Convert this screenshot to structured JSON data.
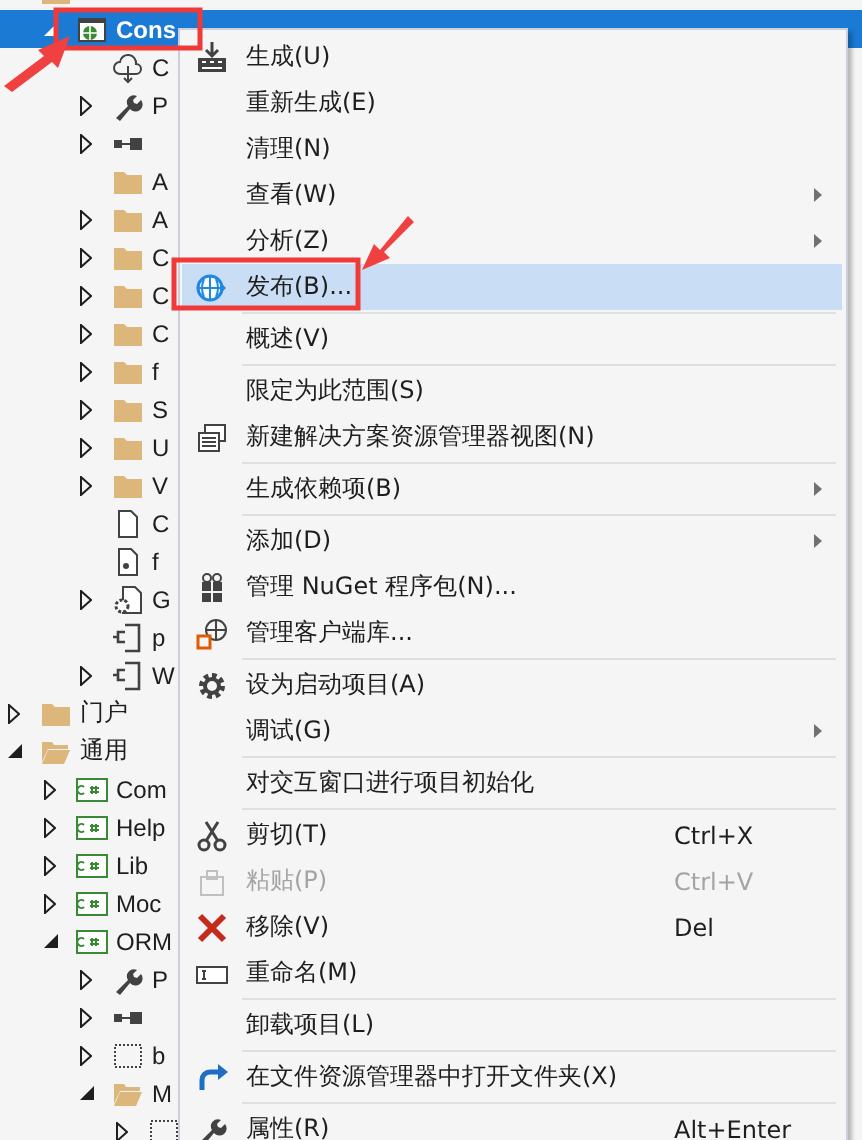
{
  "tree": {
    "items": [
      {
        "kind": "folder",
        "children": [
          {
            "label": "Cons",
            "kind": "web-project",
            "expanded": true,
            "selected": true,
            "children": [
              {
                "label": "C",
                "kind": "connected",
                "selected": false
              },
              {
                "label": "P",
                "kind": "properties",
                "expanded": false,
                "selected": false
              },
              {
                "kind": "references",
                "expanded": false,
                "selected": false
              },
              {
                "label": "A",
                "kind": "folder",
                "selected": false
              },
              {
                "label": "A",
                "kind": "folder",
                "expanded": false,
                "selected": false
              },
              {
                "label": "C",
                "kind": "folder",
                "expanded": false,
                "selected": false
              },
              {
                "label": "C",
                "kind": "folder",
                "expanded": false,
                "selected": false
              },
              {
                "label": "C",
                "kind": "folder",
                "expanded": false,
                "selected": false
              },
              {
                "label": "f",
                "kind": "folder",
                "expanded": false,
                "selected": false
              },
              {
                "label": "S",
                "kind": "folder",
                "expanded": false,
                "selected": false
              },
              {
                "label": "U",
                "kind": "folder",
                "expanded": false,
                "selected": false
              },
              {
                "label": "V",
                "kind": "folder",
                "expanded": false,
                "selected": false
              },
              {
                "label": "C",
                "kind": "file",
                "selected": false
              },
              {
                "label": "f",
                "kind": "config",
                "selected": false
              },
              {
                "label": "G",
                "kind": "settings",
                "expanded": false,
                "selected": false
              },
              {
                "label": "p",
                "kind": "profile",
                "selected": false
              },
              {
                "label": "W",
                "kind": "profile",
                "expanded": false,
                "selected": false
              }
            ]
          }
        ]
      },
      {
        "label": "门户",
        "kind": "folder",
        "expanded": false,
        "selected": false
      },
      {
        "label": "通用",
        "kind": "folder",
        "expanded": true,
        "selected": false,
        "children": [
          {
            "label": "Com",
            "kind": "csharp",
            "expanded": false,
            "selected": false
          },
          {
            "label": "Help",
            "kind": "csharp",
            "expanded": false,
            "selected": false
          },
          {
            "label": "Lib",
            "kind": "csharp",
            "expanded": false,
            "selected": false
          },
          {
            "label": "Moc",
            "kind": "csharp",
            "expanded": false,
            "selected": false
          },
          {
            "label": "ORM",
            "kind": "csharp",
            "expanded": true,
            "selected": false,
            "children": [
              {
                "label": "P",
                "kind": "properties",
                "expanded": false,
                "selected": false
              },
              {
                "kind": "references",
                "expanded": false,
                "selected": false
              },
              {
                "label": "b",
                "kind": "excluded",
                "expanded": false,
                "selected": false
              },
              {
                "label": "M",
                "kind": "folder",
                "expanded": true,
                "selected": false,
                "children": [
                  {
                    "kind": "excluded",
                    "expanded": false,
                    "selected": false
                  }
                ]
              }
            ]
          }
        ]
      }
    ]
  },
  "menu": {
    "items": [
      {
        "kind": "item",
        "label": "生成(U)",
        "selected": false,
        "disabled": false
      },
      {
        "kind": "item",
        "label": "重新生成(E)",
        "selected": false,
        "disabled": false
      },
      {
        "kind": "item",
        "label": "清理(N)",
        "selected": false,
        "disabled": false
      },
      {
        "kind": "item",
        "label": "查看(W)",
        "submenu": true,
        "selected": false,
        "disabled": false
      },
      {
        "kind": "item",
        "label": "分析(Z)",
        "submenu": true,
        "selected": false,
        "disabled": false
      },
      {
        "kind": "item",
        "label": "发布(B)...",
        "selected": true,
        "disabled": false
      },
      {
        "kind": "separator"
      },
      {
        "kind": "item",
        "label": "概述(V)",
        "selected": false,
        "disabled": false
      },
      {
        "kind": "separator"
      },
      {
        "kind": "item",
        "label": "限定为此范围(S)",
        "selected": false,
        "disabled": false
      },
      {
        "kind": "item",
        "label": "新建解决方案资源管理器视图(N)",
        "selected": false,
        "disabled": false
      },
      {
        "kind": "separator"
      },
      {
        "kind": "item",
        "label": "生成依赖项(B)",
        "submenu": true,
        "selected": false,
        "disabled": false
      },
      {
        "kind": "separator"
      },
      {
        "kind": "item",
        "label": "添加(D)",
        "submenu": true,
        "selected": false,
        "disabled": false
      },
      {
        "kind": "item",
        "label": "管理 NuGet 程序包(N)...",
        "selected": false,
        "disabled": false
      },
      {
        "kind": "item",
        "label": "管理客户端库...",
        "selected": false,
        "disabled": false
      },
      {
        "kind": "separator"
      },
      {
        "kind": "item",
        "label": "设为启动项目(A)",
        "selected": false,
        "disabled": false
      },
      {
        "kind": "item",
        "label": "调试(G)",
        "submenu": true,
        "selected": false,
        "disabled": false
      },
      {
        "kind": "separator"
      },
      {
        "kind": "item",
        "label": "对交互窗口进行项目初始化",
        "selected": false,
        "disabled": false
      },
      {
        "kind": "separator"
      },
      {
        "kind": "item",
        "label": "剪切(T)",
        "shortcut": "Ctrl+X",
        "selected": false,
        "disabled": false
      },
      {
        "kind": "item",
        "label": "粘贴(P)",
        "shortcut": "Ctrl+V",
        "selected": false,
        "disabled": true
      },
      {
        "kind": "item",
        "label": "移除(V)",
        "shortcut": "Del",
        "selected": false,
        "disabled": false
      },
      {
        "kind": "item",
        "label": "重命名(M)",
        "selected": false,
        "disabled": false
      },
      {
        "kind": "separator"
      },
      {
        "kind": "item",
        "label": "卸载项目(L)",
        "selected": false,
        "disabled": false
      },
      {
        "kind": "separator"
      },
      {
        "kind": "item",
        "label": "在文件资源管理器中打开文件夹(X)",
        "selected": false,
        "disabled": false
      },
      {
        "kind": "separator"
      },
      {
        "kind": "item",
        "label": "属性(R)",
        "shortcut": "Alt+Enter",
        "selected": false,
        "disabled": false
      }
    ]
  }
}
